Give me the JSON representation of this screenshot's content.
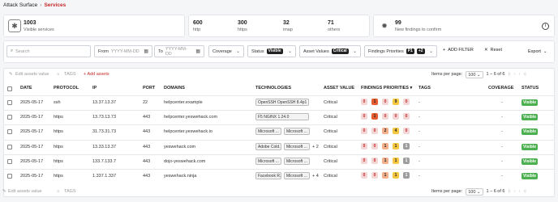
{
  "breadcrumb": {
    "root": "Attack Surface",
    "current": "Services"
  },
  "stats": {
    "visible": {
      "value": "1003",
      "label": "Visible services"
    },
    "ports": [
      {
        "value": "600",
        "label": "http"
      },
      {
        "value": "300",
        "label": "https"
      },
      {
        "value": "32",
        "label": "imap"
      },
      {
        "value": "71",
        "label": "others"
      }
    ],
    "new_findings": {
      "value": "99",
      "label": "New findings to confirm"
    }
  },
  "filters": {
    "search_placeholder": "Search",
    "from_label": "From",
    "from_placeholder": "YYYY-MM-DD",
    "to_label": "To",
    "to_placeholder": "YYYY-MM-DD",
    "coverage": "Coverage",
    "status": "Status",
    "status_chip": "Visible",
    "asset_values": "Asset Values",
    "asset_chip": "Critical",
    "findings_priorities": "Findings Priorities",
    "fp_chip1": "P1",
    "fp_chip2": "+2",
    "add_filter": "ADD FILTER",
    "reset": "Reset",
    "export": "Export"
  },
  "toolbar": {
    "edit": "Edit assets value",
    "tags": "TAGS",
    "add": "Add assets",
    "items_per_page": "Items per page:",
    "per_page": "100",
    "range": "1 – 6 of 6"
  },
  "columns": {
    "date": "DATE",
    "protocol": "PROTOCOL",
    "ip": "IP",
    "port": "PORT",
    "domains": "DOMAINS",
    "technologies": "TECHNOLOGIES",
    "asset_value": "ASSET VALUE",
    "findings": "FINDINGS PRIORITIES",
    "tags": "TAGS",
    "coverage": "COVERAGE",
    "status": "STATUS"
  },
  "rows": [
    {
      "date": "2025-05-17",
      "protocol": "ssh",
      "ip": "13.37.13.37",
      "port": "22",
      "domain": "helpcenter.example",
      "tech": [
        "OpenSSH OpenSSH 8.4p1"
      ],
      "more": "",
      "asset": "Critical",
      "sev": [
        "0",
        "1",
        "0",
        "9",
        "0"
      ],
      "tags": "-",
      "coverage": "-",
      "status": "Visible"
    },
    {
      "date": "2025-05-17",
      "protocol": "https",
      "ip": "13.73.13.73",
      "port": "443",
      "domain": "helpcenter.yeswehack.com",
      "tech": [
        "F5 NGINX 1.24.0"
      ],
      "more": "",
      "asset": "Critical",
      "sev": [
        "0",
        "1",
        "0",
        "0",
        "0"
      ],
      "tags": "-",
      "coverage": "-",
      "status": "Visible"
    },
    {
      "date": "2025-05-17",
      "protocol": "https",
      "ip": "31.73.31.73",
      "port": "443",
      "domain": "helpcenter.yeswehack.io",
      "tech": [
        "Microsoft ...",
        "Microsoft ..."
      ],
      "more": "",
      "asset": "Critical",
      "sev": [
        "0",
        "0",
        "2",
        "4",
        "0"
      ],
      "tags": "-",
      "coverage": "-",
      "status": "Visible"
    },
    {
      "date": "2025-05-17",
      "protocol": "https",
      "ip": "13.33.13.37",
      "port": "443",
      "domain": "yeswehack.com",
      "tech": [
        "Adobe Cold...",
        "Microsoft ..."
      ],
      "more": "+ 2",
      "asset": "Critical",
      "sev": [
        "0",
        "0",
        "1",
        "1",
        "1"
      ],
      "tags": "-",
      "coverage": "-",
      "status": "Visible"
    },
    {
      "date": "2025-05-17",
      "protocol": "https",
      "ip": "133.7.133.7",
      "port": "443",
      "domain": "dojo-yeswehack.com",
      "tech": [
        "Microsoft ...",
        "Microsoft ..."
      ],
      "more": "",
      "asset": "Critical",
      "sev": [
        "0",
        "0",
        "1",
        "1",
        "1"
      ],
      "tags": "-",
      "coverage": "-",
      "status": "Visible"
    },
    {
      "date": "2025-05-17",
      "protocol": "https",
      "ip": "1.337.1.337",
      "port": "443",
      "domain": "yeswehack.ninja",
      "tech": [
        "Facebook R...",
        "Microsoft ..."
      ],
      "more": "+ 4",
      "asset": "Critical",
      "sev": [
        "0",
        "0",
        "1",
        "1",
        "1"
      ],
      "tags": "-",
      "coverage": "-",
      "status": "Visible"
    }
  ],
  "sev_colors": [
    "#f3d6d6",
    "#e65c2e",
    "#f4b08a",
    "#f6c842",
    "#9e9e9e"
  ]
}
